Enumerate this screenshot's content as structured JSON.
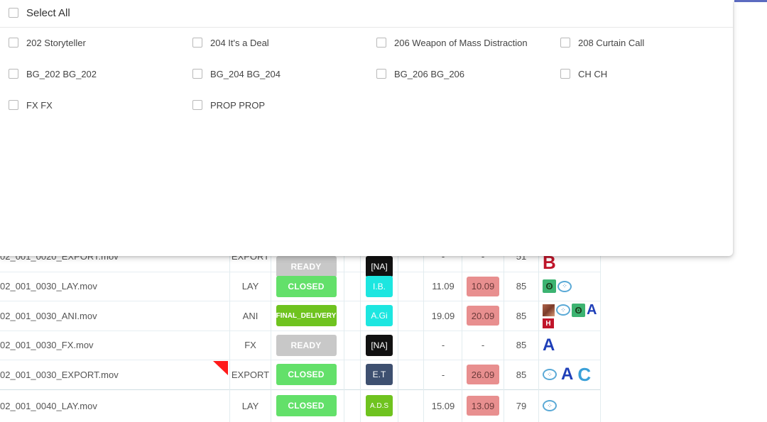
{
  "filter": {
    "select_all_label": "Select All",
    "options": [
      "202 Storyteller",
      "204 It's a Deal",
      "206 Weapon of Mass Distraction",
      "208 Curtain Call",
      "BG_202 BG_202",
      "BG_204 BG_204",
      "BG_206 BG_206",
      "CH CH",
      "FX FX",
      "PROP PROP"
    ]
  },
  "table": {
    "rows": [
      {
        "file": "02_001_0020_EXPORT.mov",
        "dept": "EXPORT",
        "status": "READY",
        "status_color": "#c8c8c8",
        "user": "[NA]",
        "user_color": "#111111",
        "start": "-",
        "due": "-",
        "due_highlight": false,
        "frames": "51",
        "icons": [
          "B-icon"
        ]
      },
      {
        "file": "02_001_0030_LAY.mov",
        "dept": "LAY",
        "status": "CLOSED",
        "status_color": "#63e06a",
        "user": "I.B.",
        "user_color": "#1de6e0",
        "start": "11.09",
        "due": "10.09",
        "due_highlight": true,
        "frames": "85",
        "icons": [
          "swirl-icon",
          "globe-icon"
        ]
      },
      {
        "file": "02_001_0030_ANI.mov",
        "dept": "ANI",
        "status": "FINAL_DELIVERY",
        "status_color": "#6fc31f",
        "user": "A.Gi",
        "user_color": "#1de6e0",
        "start": "19.09",
        "due": "20.09",
        "due_highlight": true,
        "frames": "85",
        "icons": [
          "photo-icon",
          "globe-icon",
          "swirl-icon",
          "A-icon",
          "H-icon"
        ]
      },
      {
        "file": "02_001_0030_FX.mov",
        "dept": "FX",
        "status": "READY",
        "status_color": "#c8c8c8",
        "user": "[NA]",
        "user_color": "#111111",
        "start": "-",
        "due": "-",
        "due_highlight": false,
        "frames": "85",
        "icons": [
          "A-icon"
        ]
      },
      {
        "file": "02_001_0030_EXPORT.mov",
        "dept": "EXPORT",
        "status": "CLOSED",
        "status_color": "#63e06a",
        "user": "E.T",
        "user_color": "#3e5070",
        "start": "-",
        "due": "26.09",
        "due_highlight": true,
        "frames": "85",
        "icons": [
          "globe-icon",
          "A-icon",
          "C-icon"
        ]
      },
      {
        "file": "02_001_0040_LAY.mov",
        "dept": "LAY",
        "status": "CLOSED",
        "status_color": "#63e06a",
        "user": "A.D.S",
        "user_color": "#6fc31f",
        "start": "15.09",
        "due": "13.09",
        "due_highlight": true,
        "frames": "79",
        "icons": [
          "globe-icon"
        ]
      }
    ]
  }
}
